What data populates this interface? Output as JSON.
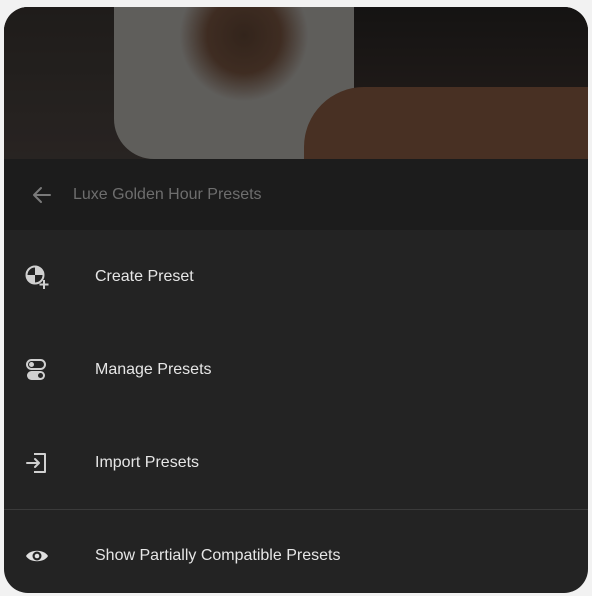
{
  "header": {
    "title": "Luxe Golden Hour Presets",
    "back_icon": "arrow-left-icon"
  },
  "menu": {
    "items": [
      {
        "label": "Create Preset",
        "icon": "create-preset-icon"
      },
      {
        "label": "Manage Presets",
        "icon": "toggles-icon"
      },
      {
        "label": "Import Presets",
        "icon": "import-icon"
      },
      {
        "label": "Show Partially Compatible Presets",
        "icon": "eye-icon"
      }
    ]
  },
  "colors": {
    "panel": "#232323",
    "header": "#1c1c1c",
    "text": "#e6e6e6",
    "muted_text": "#6e6e6e",
    "divider": "#3a3a3a"
  }
}
